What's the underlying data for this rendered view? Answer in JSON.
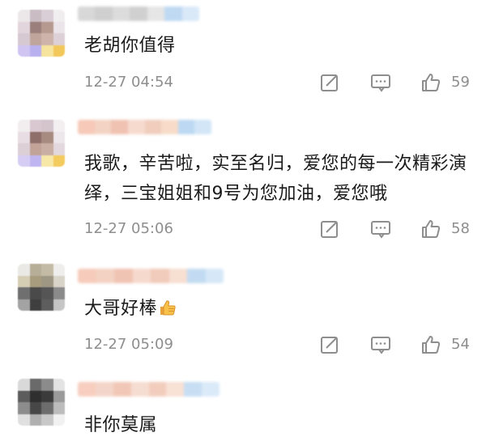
{
  "comments": [
    {
      "text": "老胡你值得",
      "time": "12-27 04:54",
      "likes": "59"
    },
    {
      "text": "我歌，辛苦啦，实至名归，爱您的每一次精彩演绎，三宝姐姐和9号为您加油，爱您哦",
      "time": "12-27 05:06",
      "likes": "58"
    },
    {
      "text": "大哥好棒",
      "time": "12-27 05:09",
      "likes": "54"
    },
    {
      "text": "非你莫属"
    }
  ],
  "icons": {
    "share": "share-icon",
    "comment": "comment-icon",
    "like": "thumbs-up-icon"
  },
  "colors": {
    "meta": "#8e8e8e",
    "text": "#1a1a1a"
  }
}
